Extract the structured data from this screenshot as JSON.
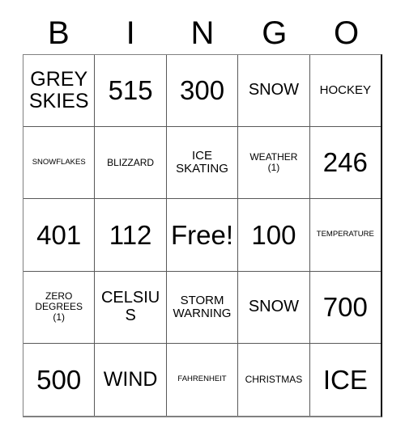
{
  "card": {
    "title": "Bingo Card",
    "header_letters": [
      "B",
      "I",
      "N",
      "G",
      "O"
    ],
    "free_space_label": "Free!",
    "colors": {
      "background": "#ffffff",
      "text": "#000000",
      "grid_line": "#595959",
      "grid_outer": "#808080"
    },
    "rows": [
      [
        {
          "text": "GREY\nSKIES",
          "size": "sz-lg"
        },
        {
          "text": "515",
          "size": "sz-xl"
        },
        {
          "text": "300",
          "size": "sz-xl"
        },
        {
          "text": "SNOW",
          "size": "sz-md"
        },
        {
          "text": "HOCKEY",
          "size": "sz-sm"
        }
      ],
      [
        {
          "text": "SNOWFLAKES",
          "size": "sz-xxs"
        },
        {
          "text": "BLIZZARD",
          "size": "sz-xs"
        },
        {
          "text": "ICE\nSKATING",
          "size": "sz-sm"
        },
        {
          "text": "WEATHER\n(1)",
          "size": "sz-xs"
        },
        {
          "text": "246",
          "size": "sz-xl"
        }
      ],
      [
        {
          "text": "401",
          "size": "sz-xl"
        },
        {
          "text": "112",
          "size": "sz-xl"
        },
        {
          "text": "Free!",
          "size": "sz-xl"
        },
        {
          "text": "100",
          "size": "sz-xl"
        },
        {
          "text": "TEMPERATURE",
          "size": "sz-xxs"
        }
      ],
      [
        {
          "text": "ZERO\nDEGREES\n(1)",
          "size": "sz-xs"
        },
        {
          "text": "CELSIUS",
          "size": "sz-md"
        },
        {
          "text": "STORM\nWARNING",
          "size": "sz-sm"
        },
        {
          "text": "SNOW",
          "size": "sz-md"
        },
        {
          "text": "700",
          "size": "sz-xl"
        }
      ],
      [
        {
          "text": "500",
          "size": "sz-xl"
        },
        {
          "text": "WIND",
          "size": "sz-lg"
        },
        {
          "text": "FAHRENHEIT",
          "size": "sz-xxs"
        },
        {
          "text": "CHRISTMAS",
          "size": "sz-xs"
        },
        {
          "text": "ICE",
          "size": "sz-xl"
        }
      ]
    ]
  }
}
